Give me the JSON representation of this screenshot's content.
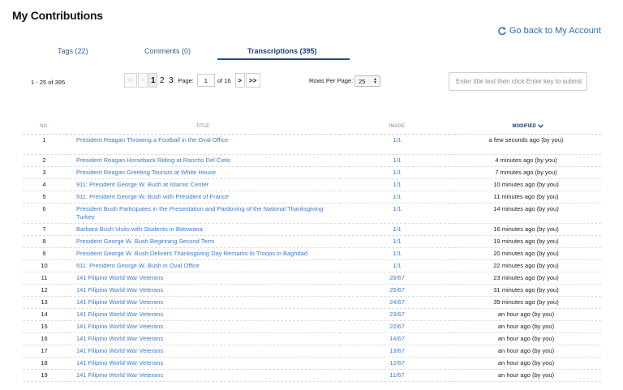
{
  "page": {
    "title": "My Contributions",
    "back_link": "Go back to My Account"
  },
  "tabs": [
    {
      "label": "Tags (22)",
      "active": false
    },
    {
      "label": "Comments (0)",
      "active": false
    },
    {
      "label": "Transcriptions (395)",
      "active": true
    }
  ],
  "toolbar": {
    "range_text": "1 - 25 of 395",
    "pager": {
      "first": "<<",
      "prev": "<",
      "pages": [
        "1",
        "2",
        "3"
      ],
      "current_page": "1",
      "page_label": "Page:",
      "page_input_value": "1",
      "of_text": "of 16",
      "next": ">",
      "last": ">>"
    },
    "rows_per_page_label": "Rows Per Page:",
    "rows_per_page_value": "25",
    "search_placeholder": "Enter title text then click Enter key to submit"
  },
  "table": {
    "headers": {
      "no": "NO.",
      "title": "TITLE",
      "image": "IMAGE",
      "modified": "MODIFIED"
    },
    "rows": [
      {
        "no": "1",
        "title": "President Reagan Throwing a Football in the Oval Office",
        "image": "1/1",
        "modified": "a few seconds ago (by you)"
      },
      {
        "no": "2",
        "title": "President Reagan Horseback Riding at Rancho Del Cielo",
        "image": "1/1",
        "modified": "4 minutes ago (by you)"
      },
      {
        "no": "3",
        "title": "President Reagan Greeting Tourists at White House",
        "image": "1/1",
        "modified": "7 minutes ago (by you)"
      },
      {
        "no": "4",
        "title": "911: President George W. Bush at Islamic Center",
        "image": "1/1",
        "modified": "10 minutes ago (by you)"
      },
      {
        "no": "5",
        "title": "911: President George W. Bush with President of France",
        "image": "1/1",
        "modified": "11 minutes ago (by you)"
      },
      {
        "no": "6",
        "title": "President Bush Participates in the Presentation and Pardoning of the National Thanksgiving Turkey",
        "image": "1/1",
        "modified": "14 minutes ago (by you)"
      },
      {
        "no": "7",
        "title": "Barbara Bush Visits with Students in Botswana",
        "image": "1/1",
        "modified": "16 minutes ago (by you)"
      },
      {
        "no": "8",
        "title": "President George W. Bush Beginning Second Term",
        "image": "1/1",
        "modified": "19 minutes ago (by you)"
      },
      {
        "no": "9",
        "title": "President George W. Bush Delivers Thanksgiving Day Remarks to Troops in Baghdad",
        "image": "1/1",
        "modified": "20 minutes ago (by you)"
      },
      {
        "no": "10",
        "title": "911: President George W. Bush in Oval Office",
        "image": "1/1",
        "modified": "22 minutes ago (by you)"
      },
      {
        "no": "11",
        "title": "141 Filipino World War Veterans",
        "image": "26/67",
        "modified": "23 minutes ago (by you)"
      },
      {
        "no": "12",
        "title": "141 Filipino World War Veterans",
        "image": "25/67",
        "modified": "31 minutes ago (by you)"
      },
      {
        "no": "13",
        "title": "141 Filipino World War Veterans",
        "image": "24/67",
        "modified": "39 minutes ago (by you)"
      },
      {
        "no": "14",
        "title": "141 Filipino World War Veterans",
        "image": "23/67",
        "modified": "an hour ago (by you)"
      },
      {
        "no": "15",
        "title": "141 Filipino World War Veterans",
        "image": "22/67",
        "modified": "an hour ago (by you)"
      },
      {
        "no": "16",
        "title": "141 Filipino World War Veterans",
        "image": "14/67",
        "modified": "an hour ago (by you)"
      },
      {
        "no": "17",
        "title": "141 Filipino World War Veterans",
        "image": "13/67",
        "modified": "an hour ago (by you)"
      },
      {
        "no": "18",
        "title": "141 Filipino World War Veterans",
        "image": "12/67",
        "modified": "an hour ago (by you)"
      },
      {
        "no": "19",
        "title": "141 Filipino World War Veterans",
        "image": "11/67",
        "modified": "an hour ago (by you)"
      }
    ]
  }
}
